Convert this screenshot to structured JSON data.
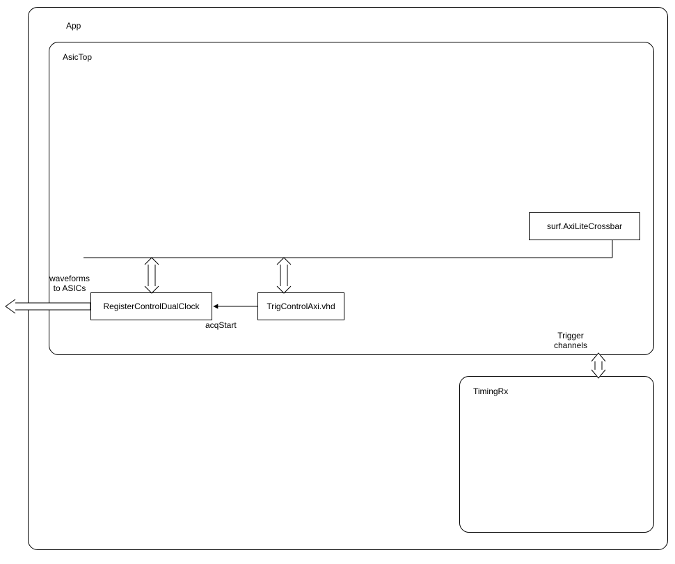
{
  "outer": {
    "title": "App"
  },
  "asicTop": {
    "title": "AsicTop"
  },
  "crossbar": {
    "label": "surf.AxiLiteCrossbar"
  },
  "regCtrl": {
    "label": "RegisterControlDualClock"
  },
  "trigCtrl": {
    "label": "TrigControlAxi.vhd"
  },
  "timingRx": {
    "title": "TimingRx"
  },
  "labels": {
    "waveforms": "waveforms\nto ASICs",
    "acqStart": "acqStart",
    "triggerChannels": "Trigger\nchannels"
  }
}
